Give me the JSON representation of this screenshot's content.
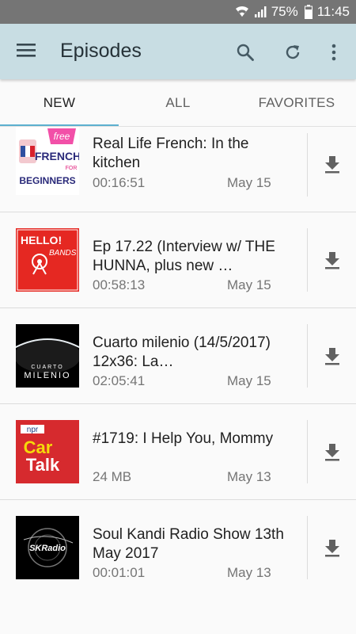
{
  "status_bar": {
    "battery": "75%",
    "time": "11:45"
  },
  "app_bar": {
    "title": "Episodes"
  },
  "tabs": [
    {
      "label": "NEW",
      "active": true
    },
    {
      "label": "ALL",
      "active": false
    },
    {
      "label": "FAVORITES",
      "active": false
    }
  ],
  "episodes": [
    {
      "title": "Real Life French: In the kitchen",
      "meta": "00:16:51",
      "date": "May 15",
      "thumb": {
        "line1": "free",
        "line2": "FRENCH",
        "line3": "FOR",
        "line4": "BEGINNERS"
      }
    },
    {
      "title": "Ep 17.22 (Interview w/ THE HUNNA, plus new …",
      "meta": "00:58:13",
      "date": "May 15",
      "thumb": {
        "line1": "HELLO!",
        "line2": "BANDS"
      }
    },
    {
      "title": "Cuarto milenio (14/5/2017) 12x36: La…",
      "meta": "02:05:41",
      "date": "May 15",
      "thumb": {
        "line1": "CUARTO",
        "line2": "MILENIO"
      }
    },
    {
      "title": "#1719: I Help You, Mommy",
      "meta": "24 MB",
      "date": "May 13",
      "thumb": {
        "line1": "npr",
        "line2": "Car",
        "line3": "Talk"
      }
    },
    {
      "title": "Soul Kandi Radio Show 13th May 2017",
      "meta": "00:01:01",
      "date": "May 13",
      "thumb": {
        "line1": "SKRadio"
      }
    }
  ]
}
